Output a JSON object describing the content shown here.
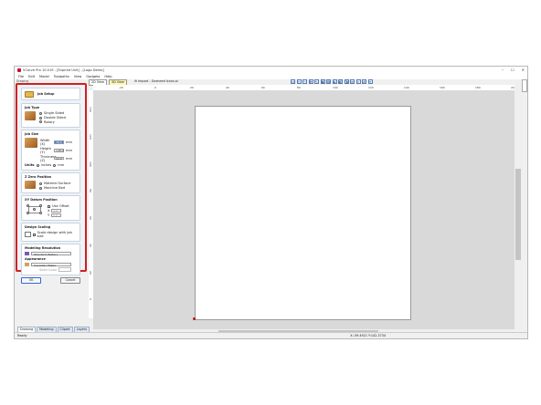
{
  "window": {
    "title": "VCarve Pro 10.019 - [Expired Unit] - [Logo Demo]",
    "controls": [
      "–",
      "☐",
      "✕"
    ]
  },
  "menu": [
    "File",
    "Edit",
    "Model",
    "Toolpaths",
    "View",
    "Gadgets",
    "Help"
  ],
  "panel_header": "Drawing",
  "job_setup": {
    "title": "Job Setup",
    "job_type": {
      "label": "Job Type",
      "options": [
        "Single Sided",
        "Double Sided",
        "Rotary"
      ],
      "selected": 0
    },
    "job_size": {
      "label": "Job Size",
      "width_label": "Width (X)",
      "width_value": "76.0",
      "height_label": "Height (Y)",
      "height_value": "148.0",
      "thickness_label": "Thickness (Z)",
      "thickness_value": "12.0",
      "unit": "mm",
      "units_label": "Units",
      "units_options": [
        "inches",
        "mm"
      ],
      "units_selected": 1
    },
    "z_zero": {
      "label": "Z Zero Position",
      "options": [
        "Material Surface",
        "Machine Bed"
      ],
      "selected": 0
    },
    "xy_datum": {
      "label": "XY Datum Position",
      "use_offset": "Use Offset",
      "x_label": "X",
      "x_value": "0.0",
      "y_label": "Y",
      "y_value": "0.0"
    },
    "design_scaling": {
      "label": "Design Scaling",
      "checkbox": "Scale design with job size"
    },
    "modeling_resolution": {
      "label": "Modeling Resolution",
      "value": "Standard (faster)"
    },
    "appearance": {
      "label": "Appearance",
      "value": "Canadian Maple",
      "shade_label": "Solid Color"
    },
    "ok": "OK",
    "cancel": "Cancel"
  },
  "bottom_tabs": [
    "Drawing",
    "Modeling",
    "Clipart",
    "Layers"
  ],
  "status": {
    "left": "Ready",
    "coords": "X:-59.4921 Y:142.3734"
  },
  "view_tabs": [
    "2D View",
    "3D View"
  ],
  "import_label": "Import - Gezneed Icons.ai",
  "ruler_h_labels": [
    "-20",
    "0",
    "20",
    "40",
    "60",
    "80",
    "100",
    "120",
    "140",
    "160",
    "180",
    "200"
  ],
  "ruler_v_labels": [
    "140",
    "120",
    "100",
    "80",
    "60",
    "40",
    "20",
    "0"
  ],
  "toolbar_icons": [
    "zoom-fit",
    "zoom-in",
    "zoom-out",
    "pan",
    "select",
    "view-top",
    "view-front",
    "view-iso",
    "view-left",
    "view-right",
    "layers",
    "snap",
    "grid",
    "measure"
  ],
  "colors": {
    "frame_red": "#d21f1f",
    "canvas": "#d9d9d9",
    "sheet": "#ffffff",
    "panel_bg": "#eef3f9",
    "tab_blue": "#dbe6f3"
  }
}
